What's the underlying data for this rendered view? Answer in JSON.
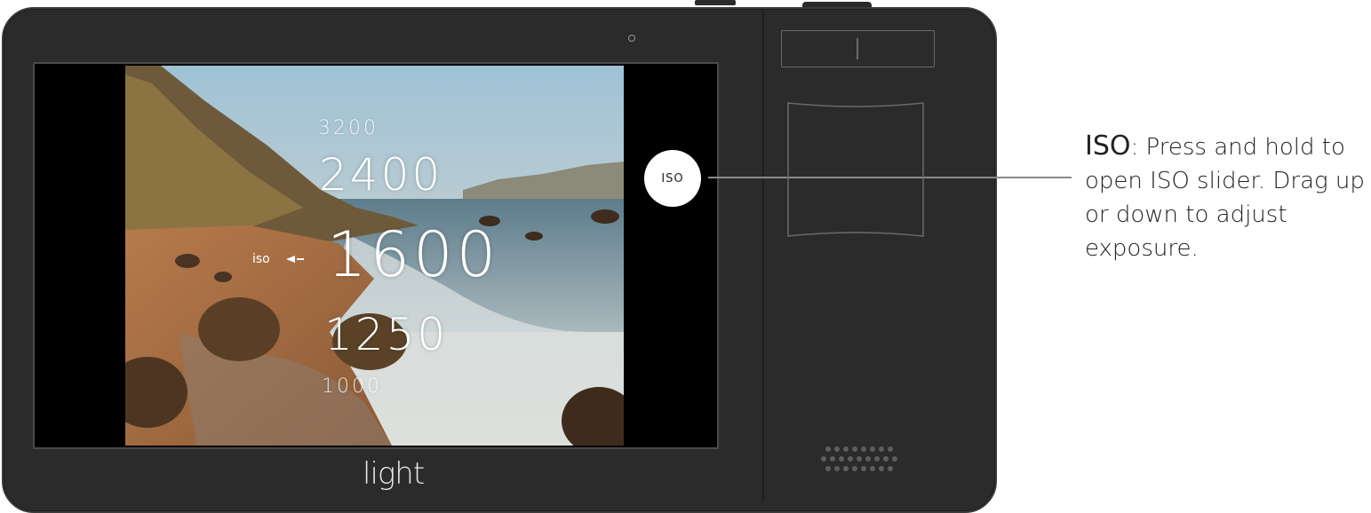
{
  "screen": {
    "iso_values": [
      "3200",
      "2400",
      "1600",
      "1250",
      "1000"
    ],
    "iso_label": "iso",
    "iso_button_label": "ISO"
  },
  "brand": {
    "logo_text": "light"
  },
  "callout": {
    "term": "ISO",
    "description": ": Press and hold to open ISO slider. Drag up or down to adjust exposure."
  },
  "colors": {
    "camera_body": "#2b2b2b",
    "screen_bg": "#000000",
    "button": "#ffffff"
  }
}
